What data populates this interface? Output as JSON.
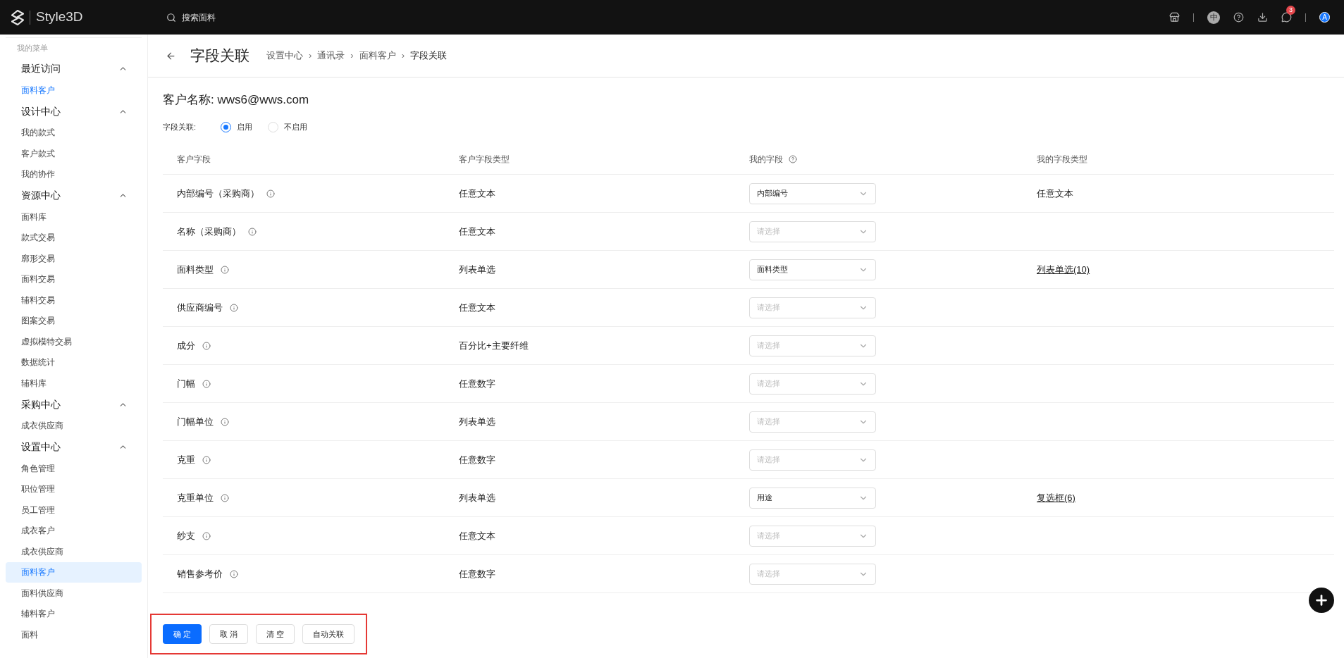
{
  "topbar": {
    "logo_text": "Style3D",
    "search": {
      "placeholder": "搜索面料"
    },
    "lang_icon_label": "中",
    "notification_count": "3",
    "avatar_letter": "A"
  },
  "sidebar": {
    "heading": "我的菜单",
    "groups": [
      {
        "label": "最近访问",
        "expanded": true,
        "children": [
          {
            "label": "面料客户",
            "selected": false,
            "highlight": true
          }
        ]
      },
      {
        "label": "设计中心",
        "expanded": true,
        "children": [
          {
            "label": "我的款式",
            "selected": false
          },
          {
            "label": "客户款式",
            "selected": false
          },
          {
            "label": "我的协作",
            "selected": false
          }
        ]
      },
      {
        "label": "资源中心",
        "expanded": true,
        "children": [
          {
            "label": "面料库",
            "selected": false
          },
          {
            "label": "款式交易",
            "selected": false
          },
          {
            "label": "廓形交易",
            "selected": false
          },
          {
            "label": "面料交易",
            "selected": false
          },
          {
            "label": "辅料交易",
            "selected": false
          },
          {
            "label": "图案交易",
            "selected": false
          },
          {
            "label": "虚拟模特交易",
            "selected": false
          },
          {
            "label": "数据统计",
            "selected": false
          },
          {
            "label": "辅料库",
            "selected": false
          }
        ]
      },
      {
        "label": "采购中心",
        "expanded": true,
        "children": [
          {
            "label": "成衣供应商",
            "selected": false
          }
        ]
      },
      {
        "label": "设置中心",
        "expanded": true,
        "children": [
          {
            "label": "角色管理",
            "selected": false
          },
          {
            "label": "职位管理",
            "selected": false
          },
          {
            "label": "员工管理",
            "selected": false
          },
          {
            "label": "成衣客户",
            "selected": false
          },
          {
            "label": "成衣供应商",
            "selected": false
          },
          {
            "label": "面料客户",
            "selected": true
          },
          {
            "label": "面料供应商",
            "selected": false
          },
          {
            "label": "辅料客户",
            "selected": false
          },
          {
            "label": "面料",
            "selected": false
          }
        ]
      }
    ]
  },
  "header": {
    "title": "字段关联",
    "breadcrumb": [
      {
        "label": "设置中心"
      },
      {
        "separator": "›",
        "label": "通讯录"
      },
      {
        "separator": "›",
        "label": "面料客户"
      },
      {
        "separator": "›",
        "label": "字段关联"
      }
    ]
  },
  "customer_name": "客户名称: wws6@wws.com",
  "field_link": {
    "label": "字段关联:",
    "options": [
      {
        "label": "启用",
        "selected": true
      },
      {
        "label": "不启用",
        "selected": false
      }
    ]
  },
  "table": {
    "columns": [
      "客户字段",
      "客户字段类型",
      "我的字段",
      "我的字段类型"
    ],
    "rows": [
      {
        "field": "内部编号（采购商）",
        "type": "任意文本",
        "my_field": {
          "value": "内部编号"
        },
        "my_type": {
          "kind": "text",
          "text": "任意文本"
        }
      },
      {
        "field": "名称（采购商）",
        "type": "任意文本",
        "my_field": {
          "placeholder": "请选择"
        }
      },
      {
        "field": "面料类型",
        "type": "列表单选",
        "my_field": {
          "value": "面料类型"
        },
        "my_type": {
          "kind": "link",
          "text": "列表单选(10)"
        }
      },
      {
        "field": "供应商编号",
        "type": "任意文本",
        "my_field": {
          "placeholder": "请选择"
        }
      },
      {
        "field": "成分",
        "type": "百分比+主要纤维",
        "my_field": {
          "placeholder": "请选择"
        }
      },
      {
        "field": "门幅",
        "type": "任意数字",
        "my_field": {
          "placeholder": "请选择"
        }
      },
      {
        "field": "门幅单位",
        "type": "列表单选",
        "my_field": {
          "placeholder": "请选择"
        }
      },
      {
        "field": "克重",
        "type": "任意数字",
        "my_field": {
          "placeholder": "请选择"
        }
      },
      {
        "field": "克重单位",
        "type": "列表单选",
        "my_field": {
          "value": "用途"
        },
        "my_type": {
          "kind": "link",
          "text": "复选框(6)"
        }
      },
      {
        "field": "纱支",
        "type": "任意文本",
        "my_field": {
          "placeholder": "请选择"
        }
      },
      {
        "field": "销售参考价",
        "type": "任意数字",
        "my_field": {
          "placeholder": "请选择"
        }
      }
    ]
  },
  "footer": {
    "buttons": [
      {
        "label": "确 定",
        "kind": "primary"
      },
      {
        "label": "取 消",
        "kind": "default"
      },
      {
        "label": "清 空",
        "kind": "default"
      },
      {
        "label": "自动关联",
        "kind": "default"
      }
    ]
  }
}
